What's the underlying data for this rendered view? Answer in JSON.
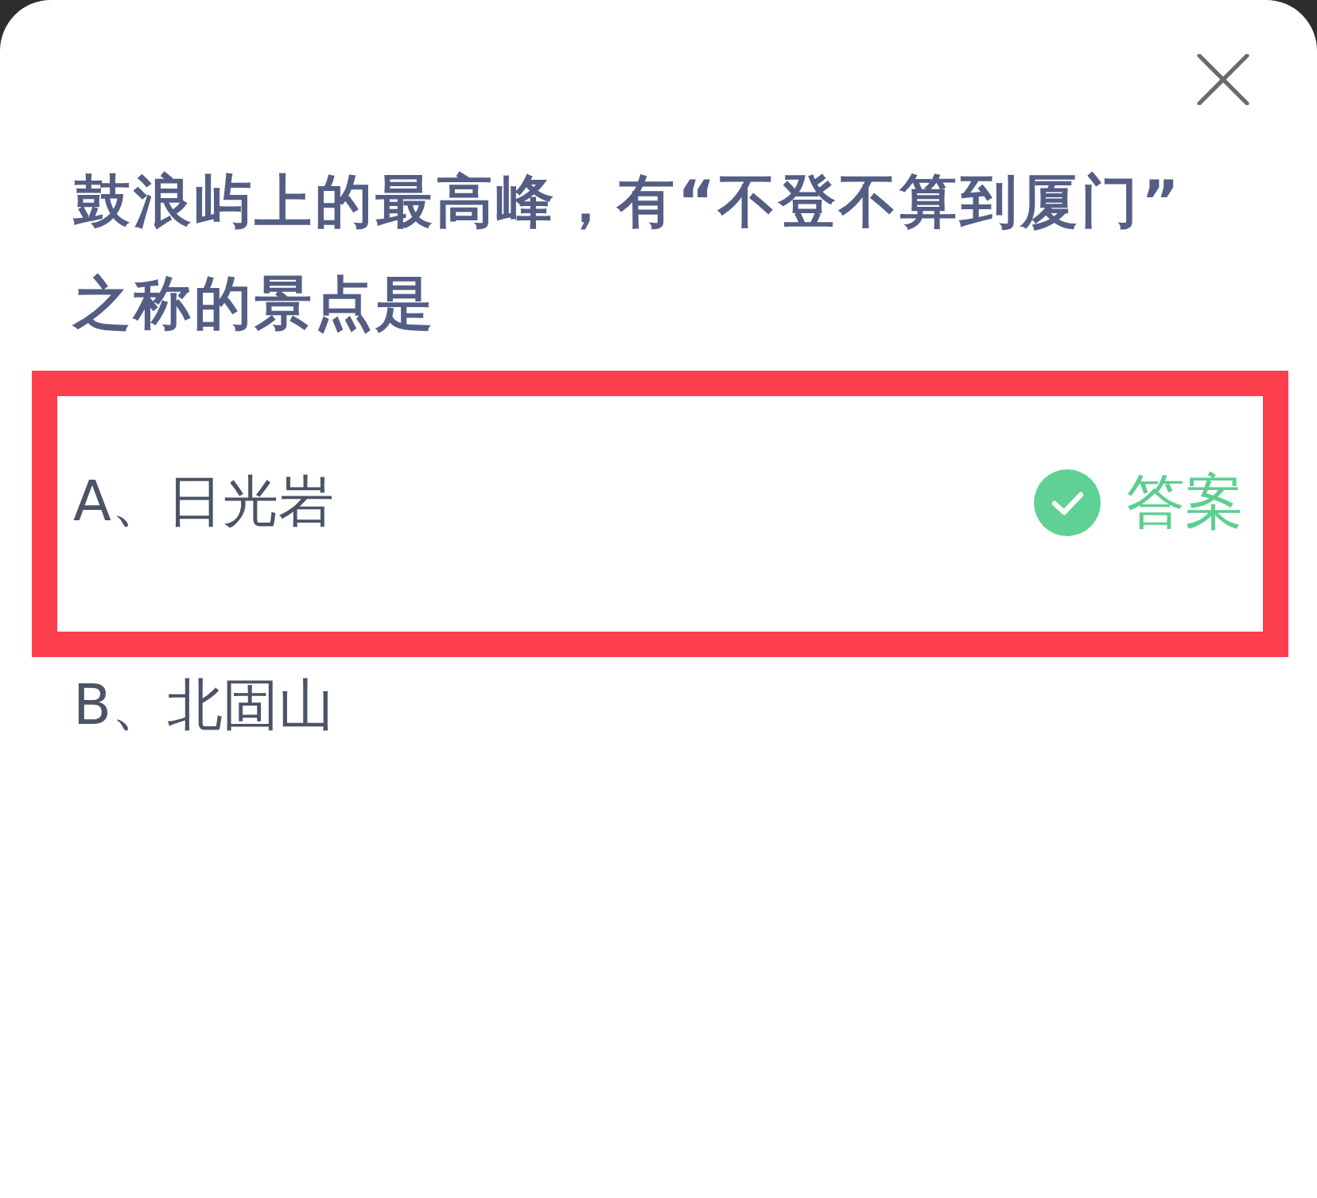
{
  "question": "鼓浪屿上的最高峰，有“不登不算到厦门”之称的景点是",
  "options": [
    {
      "label": "A、日光岩",
      "correct": true,
      "answer_label": "答案",
      "highlighted": true
    },
    {
      "label": "B、北固山",
      "correct": false,
      "highlighted": false
    }
  ]
}
